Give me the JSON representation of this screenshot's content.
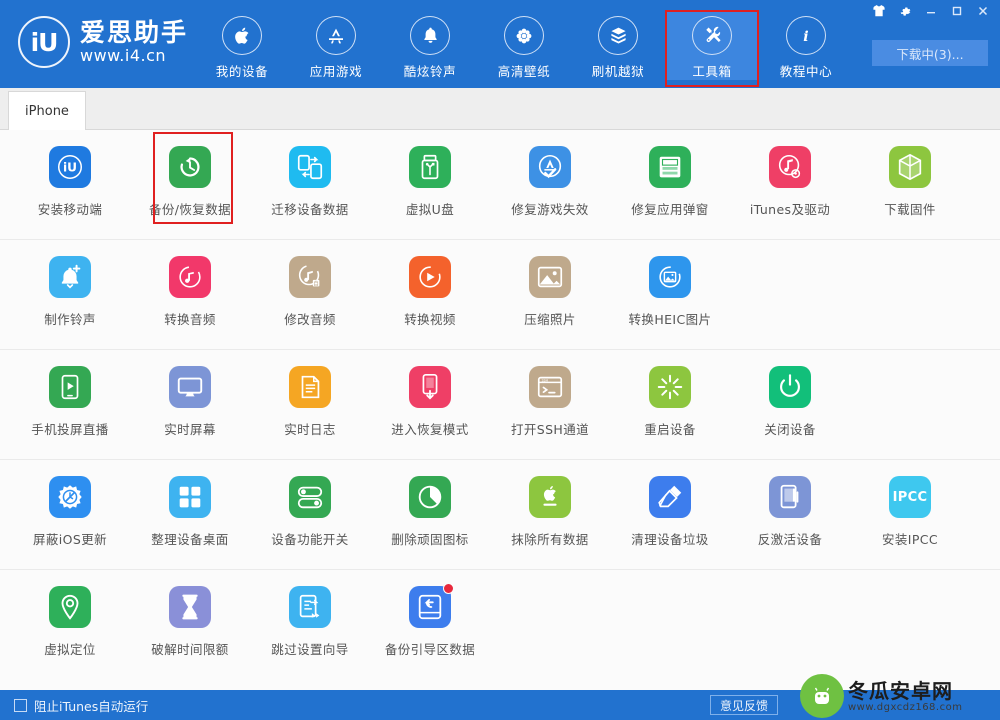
{
  "window": {
    "controls": [
      {
        "name": "skin-icon",
        "glyph": "skin"
      },
      {
        "name": "gear-icon",
        "glyph": "gear"
      },
      {
        "name": "minimize-icon",
        "glyph": "minimize"
      },
      {
        "name": "maximize-icon",
        "glyph": "maximize"
      },
      {
        "name": "close-icon",
        "glyph": "close"
      }
    ]
  },
  "brand": {
    "mark": "iU",
    "name_cn": "爱思助手",
    "url": "www.i4.cn"
  },
  "nav": {
    "items": [
      {
        "label": "我的设备",
        "icon": "apple-icon",
        "active": false,
        "highlight": false
      },
      {
        "label": "应用游戏",
        "icon": "appstore-icon",
        "active": false,
        "highlight": false
      },
      {
        "label": "酷炫铃声",
        "icon": "bell-icon",
        "active": false,
        "highlight": false
      },
      {
        "label": "高清壁纸",
        "icon": "flower-icon",
        "active": false,
        "highlight": false
      },
      {
        "label": "刷机越狱",
        "icon": "box-open-icon",
        "active": false,
        "highlight": false
      },
      {
        "label": "工具箱",
        "icon": "wrench-icon",
        "active": true,
        "highlight": true
      },
      {
        "label": "教程中心",
        "icon": "info-icon",
        "active": false,
        "highlight": false
      }
    ]
  },
  "download_button": {
    "label": "下载中(3)..."
  },
  "tabs": [
    {
      "label": "iPhone",
      "active": true
    }
  ],
  "toolbox": {
    "rows": [
      [
        {
          "label": "安装移动端",
          "icon": "i4-app-icon",
          "color": "#1f7ae0",
          "highlight": false
        },
        {
          "label": "备份/恢复数据",
          "icon": "backup-restore-icon",
          "color": "#34a853",
          "highlight": true
        },
        {
          "label": "迁移设备数据",
          "icon": "device-migrate-icon",
          "color": "#1fbbf0",
          "highlight": false
        },
        {
          "label": "虚拟U盘",
          "icon": "usb-drive-icon",
          "color": "#2eb05a",
          "highlight": false
        },
        {
          "label": "修复游戏失效",
          "icon": "appstore-fix-icon",
          "color": "#3d91e5",
          "highlight": false
        },
        {
          "label": "修复应用弹窗",
          "icon": "apple-id-icon",
          "color": "#2eb05a",
          "highlight": false
        },
        {
          "label": "iTunes及驱动",
          "icon": "itunes-driver-icon",
          "color": "#ef3f66",
          "highlight": false
        },
        {
          "label": "下载固件",
          "icon": "firmware-box-icon",
          "color": "#8dc63f",
          "highlight": false
        }
      ],
      [
        {
          "label": "制作铃声",
          "icon": "ringtone-make-icon",
          "color": "#3eb3f0",
          "highlight": false
        },
        {
          "label": "转换音频",
          "icon": "audio-convert-icon",
          "color": "#f2386a",
          "highlight": false
        },
        {
          "label": "修改音频",
          "icon": "audio-edit-icon",
          "color": "#bfa98c",
          "highlight": false
        },
        {
          "label": "转换视频",
          "icon": "video-convert-icon",
          "color": "#f4622c",
          "highlight": false
        },
        {
          "label": "压缩照片",
          "icon": "photo-compress-icon",
          "color": "#bfa98c",
          "highlight": false
        },
        {
          "label": "转换HEIC图片",
          "icon": "heic-convert-icon",
          "color": "#2e96ed",
          "highlight": false
        }
      ],
      [
        {
          "label": "手机投屏直播",
          "icon": "screen-cast-icon",
          "color": "#34a853",
          "highlight": false
        },
        {
          "label": "实时屏幕",
          "icon": "realtime-screen-icon",
          "color": "#7d95d6",
          "highlight": false
        },
        {
          "label": "实时日志",
          "icon": "realtime-log-icon",
          "color": "#f5a623",
          "highlight": false
        },
        {
          "label": "进入恢复模式",
          "icon": "recovery-mode-icon",
          "color": "#ef3f66",
          "highlight": false
        },
        {
          "label": "打开SSH通道",
          "icon": "ssh-terminal-icon",
          "color": "#bfa98c",
          "highlight": false
        },
        {
          "label": "重启设备",
          "icon": "restart-device-icon",
          "color": "#8dc63f",
          "highlight": false
        },
        {
          "label": "关闭设备",
          "icon": "power-off-icon",
          "color": "#12bf7a",
          "highlight": false
        }
      ],
      [
        {
          "label": "屏蔽iOS更新",
          "icon": "block-update-icon",
          "color": "#2e8ff0",
          "highlight": false
        },
        {
          "label": "整理设备桌面",
          "icon": "organize-desktop-icon",
          "color": "#3eb3f0",
          "highlight": false
        },
        {
          "label": "设备功能开关",
          "icon": "feature-toggle-icon",
          "color": "#34a853",
          "highlight": false
        },
        {
          "label": "删除顽固图标",
          "icon": "remove-icon-icon",
          "color": "#34a853",
          "highlight": false
        },
        {
          "label": "抹除所有数据",
          "icon": "erase-all-icon",
          "color": "#8dc63f",
          "highlight": false
        },
        {
          "label": "清理设备垃圾",
          "icon": "clean-junk-icon",
          "color": "#3d7ded",
          "highlight": false
        },
        {
          "label": "反激活设备",
          "icon": "deactivate-icon",
          "color": "#7d95d6",
          "highlight": false
        },
        {
          "label": "安装IPCC",
          "icon": "ipcc-install-icon",
          "color": "#3ec8ef",
          "highlight": false,
          "text": "IPCC"
        }
      ],
      [
        {
          "label": "虚拟定位",
          "icon": "virtual-location-icon",
          "color": "#2eb05a",
          "highlight": false
        },
        {
          "label": "破解时间限额",
          "icon": "time-limit-icon",
          "color": "#8a90d8",
          "highlight": false
        },
        {
          "label": "跳过设置向导",
          "icon": "skip-setup-icon",
          "color": "#3eb3f0",
          "highlight": false
        },
        {
          "label": "备份引导区数据",
          "icon": "backup-boot-icon",
          "color": "#3d7ded",
          "highlight": false,
          "badge": true
        }
      ]
    ]
  },
  "footer": {
    "checkbox_label": "阻止iTunes自动运行",
    "checkbox_checked": false,
    "feedback_label": "意见反馈"
  },
  "watermark": {
    "name_cn": "冬瓜安卓网",
    "url": "www.dgxcdz168.com"
  },
  "colors": {
    "header_blue": "#2272cf",
    "active_nav": "#3d86df",
    "highlight_red": "#e02020",
    "content_bg": "#fbfbfb"
  }
}
